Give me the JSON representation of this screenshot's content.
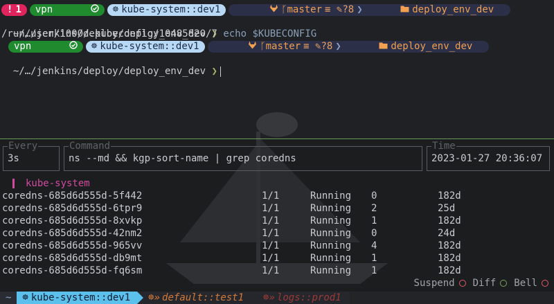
{
  "prompt1": {
    "error_icon": "!",
    "error_count": "1",
    "vpn_label": "vpn",
    "vpn_icon": "check-circle-icon",
    "kube_icon": "helm-icon",
    "kube_context": "kube-system::dev1",
    "git_icon": "gitlab-icon",
    "git_branch": "master",
    "git_status": "≡ ✎?8",
    "folder_icon": "folder-icon",
    "folder_name": "deploy_env_dev"
  },
  "line1": {
    "path": "~/…/jenkins/deploy/deploy_env_dev",
    "arrow": "❯",
    "command": "echo $KUBECONFIG"
  },
  "output1": "/run/user/1000/.kubeconfig/10485820/7",
  "prompt2": {
    "vpn_label": "vpn",
    "kube_context": "kube-system::dev1",
    "git_branch": "master",
    "git_status": "≡ ✎?8",
    "folder_name": "deploy_env_dev"
  },
  "line2": {
    "path": "~/…/jenkins/deploy/deploy_env_dev",
    "arrow": "❯"
  },
  "watch": {
    "every_label": "Every",
    "every_value": "3s",
    "command_label": "Command",
    "command_value": "ns --md && kgp-sort-name | grep coredns",
    "time_label": "Time",
    "time_value": "2023-01-27 20:36:07"
  },
  "namespace": "kube-system",
  "pods": [
    {
      "name": "coredns-685d6d555d-5f442",
      "ready": "1/1",
      "status": "Running",
      "restarts": "0",
      "age": "182d"
    },
    {
      "name": "coredns-685d6d555d-6tpr9",
      "ready": "1/1",
      "status": "Running",
      "restarts": "2",
      "age": "25d"
    },
    {
      "name": "coredns-685d6d555d-8xvkp",
      "ready": "1/1",
      "status": "Running",
      "restarts": "1",
      "age": "182d"
    },
    {
      "name": "coredns-685d6d555d-42nm2",
      "ready": "1/1",
      "status": "Running",
      "restarts": "0",
      "age": "24d"
    },
    {
      "name": "coredns-685d6d555d-965vv",
      "ready": "1/1",
      "status": "Running",
      "restarts": "4",
      "age": "182d"
    },
    {
      "name": "coredns-685d6d555d-db9mt",
      "ready": "1/1",
      "status": "Running",
      "restarts": "1",
      "age": "182d"
    },
    {
      "name": "coredns-685d6d555d-fq6sm",
      "ready": "1/1",
      "status": "Running",
      "restarts": "1",
      "age": "182d"
    }
  ],
  "indicators": {
    "suspend": "Suspend",
    "diff": "Diff",
    "bell": "Bell"
  },
  "statusbar": {
    "home": "~",
    "active_tab": "kube-system::dev1",
    "tab2": "default::test1",
    "tab3": "logs::prod1"
  },
  "colors": {
    "error": "#e0245e",
    "vpn": "#1f8a2e",
    "kube": "#b8d9f5",
    "git": "#2b2f48",
    "namespace": "#d14aa0",
    "active_tab": "#5cc0ec"
  }
}
